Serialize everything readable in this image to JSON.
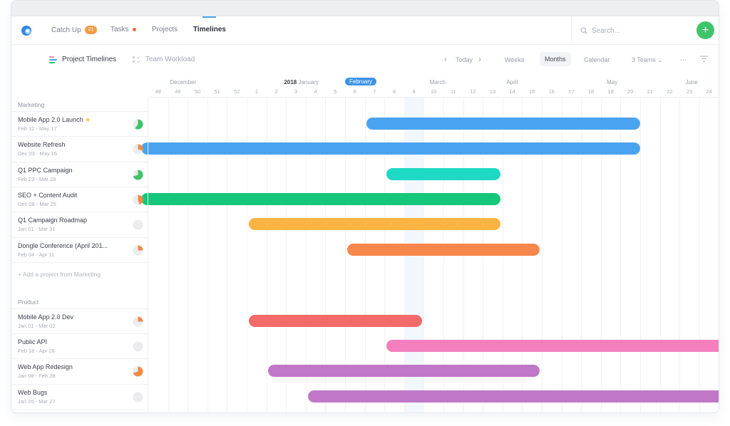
{
  "nav": {
    "items": [
      {
        "label": "Catch Up",
        "badge": "21"
      },
      {
        "label": "Tasks",
        "dot": true
      },
      {
        "label": "Projects"
      },
      {
        "label": "Timelines",
        "active": true
      }
    ],
    "search_placeholder": "Search...",
    "add_button": "+"
  },
  "subbar": {
    "views": [
      {
        "label": "Project Timelines",
        "active": true,
        "icon": "timeline-icon"
      },
      {
        "label": "Team Workload",
        "active": false,
        "icon": "workload-icon"
      }
    ],
    "prev": "‹",
    "today": "Today",
    "next": "›",
    "modes": [
      "Weeks",
      "Months",
      "Calendar"
    ],
    "selected_mode": "Months",
    "teams": "3 Teams",
    "more": "···"
  },
  "timeline": {
    "year": "2018",
    "months": [
      {
        "label": "December",
        "col": 1.1
      },
      {
        "label": "January",
        "col": 6.9,
        "year": true
      },
      {
        "label": "February",
        "col": 10,
        "current": true
      },
      {
        "label": "March",
        "col": 14.3
      },
      {
        "label": "April",
        "col": 18.2
      },
      {
        "label": "May",
        "col": 23.3
      },
      {
        "label": "June",
        "col": 27.3
      }
    ],
    "weeks": [
      "48",
      "49",
      "50",
      "51",
      "52",
      "1",
      "2",
      "3",
      "4",
      "5",
      "6",
      "7",
      "8",
      "9",
      "10",
      "11",
      "12",
      "13",
      "14",
      "15",
      "16",
      "17",
      "18",
      "19",
      "20",
      "21",
      "22",
      "23",
      "24"
    ],
    "highlight_week": "9"
  },
  "groups": [
    {
      "name": "Marketing",
      "add_label": "+ Add a project from Marketing",
      "projects": [
        {
          "name": "Mobile App 2.0 Launch",
          "starred": true,
          "dates": "Feb 12 - May 17",
          "progress": 0.6,
          "progress_color": "#3fc46a",
          "bar_color": "#4aa3f0",
          "start": 11.1,
          "end": 25.0
        },
        {
          "name": "Website Refresh",
          "dates": "Dec 03 - May 16",
          "progress": 0.3,
          "progress_color": "#f38a45",
          "bar_color": "#4aa3f0",
          "start": 0,
          "end": 25.0
        },
        {
          "name": "Q1 PPC Campaign",
          "dates": "Feb 23 - Mar 28",
          "progress": 0.7,
          "progress_color": "#3fc46a",
          "bar_color": "#1ed9c3",
          "start": 12.1,
          "end": 17.9
        },
        {
          "name": "SEO + Content Audit",
          "dates": "Dec 08 - Mar 25",
          "progress": 0.45,
          "progress_color": "#f38a45",
          "bar_color": "#14c77a",
          "start": 0,
          "end": 17.9
        },
        {
          "name": "Q1 Campaign Roadmap",
          "dates": "Jan 01 - Mar 31",
          "progress": 0,
          "progress_color": "#f38a45",
          "bar_color": "#f9b443",
          "start": 5.1,
          "end": 17.9
        },
        {
          "name": "Dongle Conference (April 201...",
          "dates": "Feb 04 - Apr 11",
          "progress": 0.25,
          "progress_color": "#f38a45",
          "bar_color": "#f7874a",
          "start": 10.1,
          "end": 19.9
        }
      ]
    },
    {
      "name": "Product",
      "projects": [
        {
          "name": "Mobile App 2.0 Dev",
          "dates": "Jan 01 - Mar 02",
          "progress": 0.25,
          "progress_color": "#f38a45",
          "bar_color": "#f36a6a",
          "start": 5.1,
          "end": 13.9
        },
        {
          "name": "Public API",
          "dates": "Feb 18 - Apr 28",
          "progress": 0,
          "progress_color": "#f38a45",
          "bar_color": "#f37fbf",
          "start": 12.1,
          "end": 29
        },
        {
          "name": "Web App Redesign",
          "dates": "Jan 08 - Feb 28",
          "progress": 0.7,
          "progress_color": "#f38a45",
          "bar_color": "#c077c8",
          "start": 6.1,
          "end": 19.9
        },
        {
          "name": "Web Bugs",
          "dates": "Jan 26 - Mar 27",
          "progress": 0,
          "progress_color": "#f38a45",
          "bar_color": "#c077c8",
          "start": 8.1,
          "end": 29
        }
      ]
    }
  ]
}
